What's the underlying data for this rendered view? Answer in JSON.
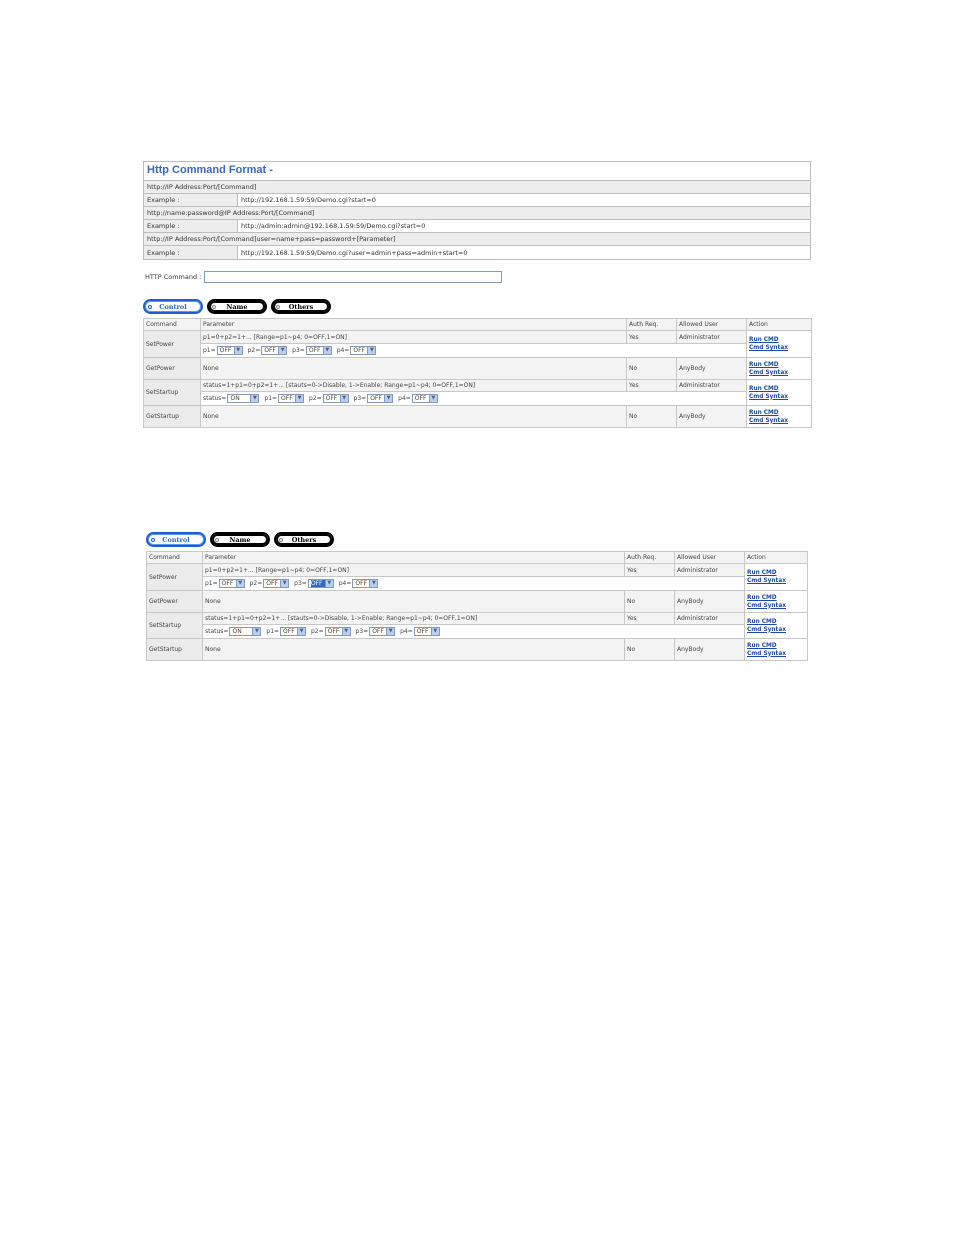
{
  "format": {
    "title": "Http Command Format -",
    "rows": [
      {
        "type": "full",
        "text": "http://IP Address:Port/[Command]"
      },
      {
        "type": "pair",
        "label": "Example :",
        "value": "http://192.168.1.59:59/Demo.cgi?start=0"
      },
      {
        "type": "full",
        "text": "http://name:password@IP Address:Port/[Command]"
      },
      {
        "type": "pair",
        "label": "Example :",
        "value": "http://admin:admin@192.168.1.59:59/Demo.cgi?start=0"
      },
      {
        "type": "full",
        "text": "http://IP Address:Port/[Command]user=name+pass=password+[Parameter]"
      },
      {
        "type": "pair",
        "label": "Example :",
        "value": "http://192.168.1.59:59/Demo.cgi?user=admin+pass=admin+start=0"
      }
    ]
  },
  "http_command_label": "HTTP Command :",
  "http_command_value": "",
  "tabs": [
    "Control",
    "Name",
    "Others"
  ],
  "table": {
    "headers": [
      "Command",
      "Parameter",
      "Auth Req.",
      "Allowed User",
      "Action"
    ],
    "run_label": "Run CMD",
    "syntax_label": "Cmd Syntax",
    "setpower": {
      "name": "SetPower",
      "param": "p1=0+p2=1+... [Range=p1~p4; 0=OFF,1=ON]",
      "auth": "Yes",
      "user": "Administrator",
      "controls": [
        {
          "label": "p1=",
          "value": "OFF"
        },
        {
          "label": "p2=",
          "value": "OFF"
        },
        {
          "label": "p3=",
          "value": "OFF"
        },
        {
          "label": "p4=",
          "value": "OFF"
        }
      ]
    },
    "getpower": {
      "name": "GetPower",
      "param": "None",
      "auth": "No",
      "user": "AnyBody"
    },
    "setstartup": {
      "name": "SetStartup",
      "param": "status=1+p1=0+p2=1+... [stauts=0->Disable, 1->Enable; Range=p1~p4; 0=OFF,1=ON]",
      "auth": "Yes",
      "user": "Administrator",
      "controls": [
        {
          "label": "status=",
          "value": "ON"
        },
        {
          "label": "p1=",
          "value": "OFF"
        },
        {
          "label": "p2=",
          "value": "OFF"
        },
        {
          "label": "p3=",
          "value": "OFF"
        },
        {
          "label": "p4=",
          "value": "OFF"
        }
      ]
    },
    "getstartup": {
      "name": "GetStartup",
      "param": "None",
      "auth": "No",
      "user": "AnyBody"
    }
  }
}
